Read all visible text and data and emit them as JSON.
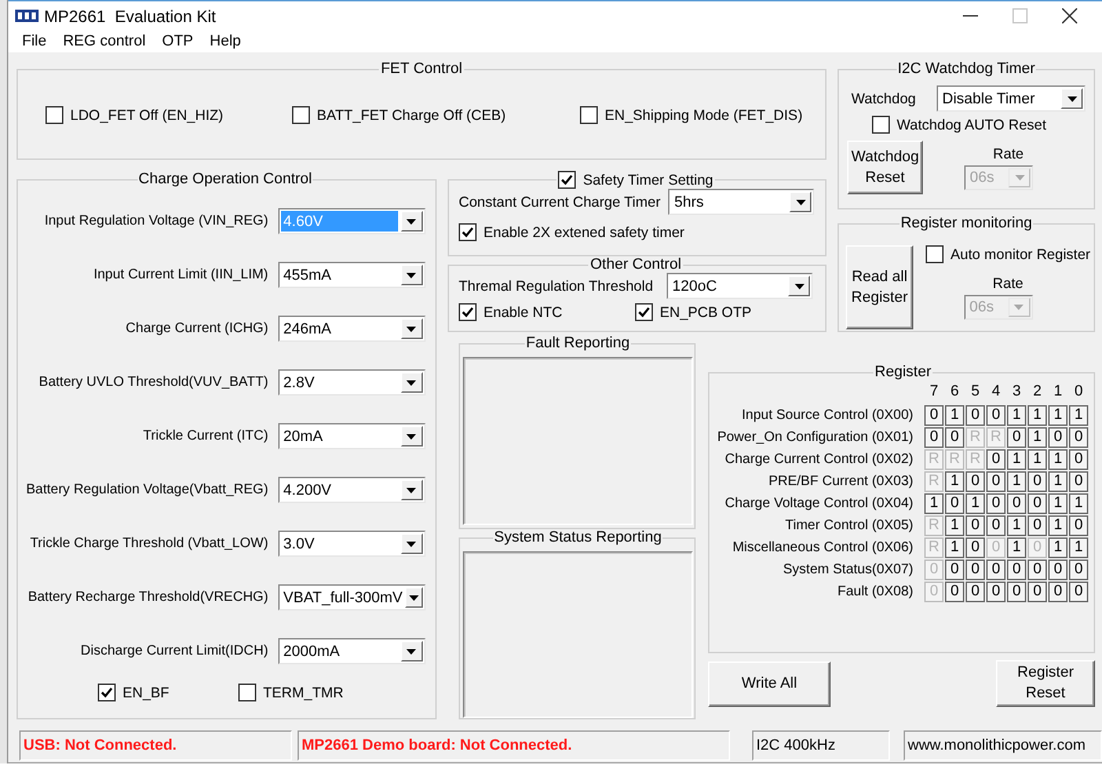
{
  "window": {
    "title": "MP2661  Evaluation Kit"
  },
  "menu": [
    "File",
    "REG control",
    "OTP",
    "Help"
  ],
  "fet_control": {
    "title": "FET Control",
    "options": [
      {
        "label": "LDO_FET Off (EN_HIZ)",
        "checked": false
      },
      {
        "label": "BATT_FET Charge Off (CEB)",
        "checked": false
      },
      {
        "label": "EN_Shipping Mode (FET_DIS)",
        "checked": false
      }
    ]
  },
  "charge_operation": {
    "title": "Charge Operation Control",
    "settings": [
      {
        "label": "Input Regulation Voltage (VIN_REG)",
        "value": "4.60V",
        "focused": true
      },
      {
        "label": "Input Current Limit (IIN_LIM)",
        "value": "455mA",
        "focused": false
      },
      {
        "label": "Charge Current (ICHG)",
        "value": "246mA",
        "focused": false
      },
      {
        "label": "Battery UVLO Threshold(VUV_BATT)",
        "value": "2.8V",
        "focused": false
      },
      {
        "label": "Trickle Current (ITC)",
        "value": "20mA",
        "focused": false
      },
      {
        "label": "Battery Regulation Voltage(Vbatt_REG)",
        "value": "4.200V",
        "focused": false
      },
      {
        "label": "Trickle Charge Threshold (Vbatt_LOW)",
        "value": "3.0V",
        "focused": false
      },
      {
        "label": "Battery Recharge Threshold(VRECHG)",
        "value": "VBAT_full-300mV",
        "focused": false
      },
      {
        "label": "Discharge Current Limit(IDCH)",
        "value": "2000mA",
        "focused": false
      }
    ],
    "options": [
      {
        "label": "EN_BF",
        "checked": true
      },
      {
        "label": "TERM_TMR",
        "checked": false
      }
    ]
  },
  "safety_timer": {
    "title": "Safety Timer Setting",
    "checked": true,
    "timer_label": "Constant Current Charge Timer",
    "timer_value": "5hrs",
    "options": [
      {
        "label": "Enable 2X extened safety timer",
        "checked": true
      }
    ]
  },
  "other_control": {
    "title": "Other Control",
    "threshold_label": "Thremal Regulation Threshold",
    "threshold_value": "120oC",
    "options": [
      {
        "label": "Enable NTC",
        "checked": true
      },
      {
        "label": "EN_PCB OTP",
        "checked": true
      }
    ]
  },
  "fault_reporting": {
    "title": "Fault Reporting"
  },
  "system_status_reporting": {
    "title": "System Status Reporting"
  },
  "watchdog": {
    "title": "I2C Watchdog Timer",
    "label": "Watchdog",
    "value": "Disable Timer",
    "auto_reset": {
      "label": "Watchdog AUTO Reset",
      "checked": false
    },
    "reset_button": "Watchdog Reset",
    "rate_label": "Rate",
    "rate": {
      "value": "06s",
      "disabled": true
    }
  },
  "register_monitoring": {
    "title": "Register monitoring",
    "read_button": "Read all Register",
    "auto_monitor": {
      "label": "Auto monitor Register",
      "checked": false
    },
    "rate_label": "Rate",
    "rate": {
      "value": "06s",
      "disabled": true
    }
  },
  "register": {
    "title": "Register",
    "bit_headers": [
      "7",
      "6",
      "5",
      "4",
      "3",
      "2",
      "1",
      "0"
    ],
    "rows": [
      {
        "label": "Input Source Control (0X00)",
        "bits": [
          {
            "text": "0",
            "disabled": false
          },
          {
            "text": "1",
            "disabled": false
          },
          {
            "text": "0",
            "disabled": false
          },
          {
            "text": "0",
            "disabled": false
          },
          {
            "text": "1",
            "disabled": false
          },
          {
            "text": "1",
            "disabled": false
          },
          {
            "text": "1",
            "disabled": false
          },
          {
            "text": "1",
            "disabled": false
          }
        ]
      },
      {
        "label": "Power_On Configuration (0X01)",
        "bits": [
          {
            "text": "0",
            "disabled": false
          },
          {
            "text": "0",
            "disabled": false
          },
          {
            "text": "R",
            "disabled": true
          },
          {
            "text": "R",
            "disabled": true
          },
          {
            "text": "0",
            "disabled": false
          },
          {
            "text": "1",
            "disabled": false
          },
          {
            "text": "0",
            "disabled": false
          },
          {
            "text": "0",
            "disabled": false
          }
        ]
      },
      {
        "label": "Charge Current Control (0X02)",
        "bits": [
          {
            "text": "R",
            "disabled": true
          },
          {
            "text": "R",
            "disabled": true
          },
          {
            "text": "R",
            "disabled": true
          },
          {
            "text": "0",
            "disabled": false
          },
          {
            "text": "1",
            "disabled": false
          },
          {
            "text": "1",
            "disabled": false
          },
          {
            "text": "1",
            "disabled": false
          },
          {
            "text": "0",
            "disabled": false
          }
        ]
      },
      {
        "label": "PRE/BF Current (0X03)",
        "bits": [
          {
            "text": "R",
            "disabled": true
          },
          {
            "text": "1",
            "disabled": false
          },
          {
            "text": "0",
            "disabled": false
          },
          {
            "text": "0",
            "disabled": false
          },
          {
            "text": "1",
            "disabled": false
          },
          {
            "text": "0",
            "disabled": false
          },
          {
            "text": "1",
            "disabled": false
          },
          {
            "text": "0",
            "disabled": false
          }
        ]
      },
      {
        "label": "Charge Voltage Control (0X04)",
        "bits": [
          {
            "text": "1",
            "disabled": false
          },
          {
            "text": "0",
            "disabled": false
          },
          {
            "text": "1",
            "disabled": false
          },
          {
            "text": "0",
            "disabled": false
          },
          {
            "text": "0",
            "disabled": false
          },
          {
            "text": "0",
            "disabled": false
          },
          {
            "text": "1",
            "disabled": false
          },
          {
            "text": "1",
            "disabled": false
          }
        ]
      },
      {
        "label": "Timer Control (0X05)",
        "bits": [
          {
            "text": "R",
            "disabled": true
          },
          {
            "text": "1",
            "disabled": false
          },
          {
            "text": "0",
            "disabled": false
          },
          {
            "text": "0",
            "disabled": false
          },
          {
            "text": "1",
            "disabled": false
          },
          {
            "text": "0",
            "disabled": false
          },
          {
            "text": "1",
            "disabled": false
          },
          {
            "text": "0",
            "disabled": false
          }
        ]
      },
      {
        "label": "Miscellaneous Control (0X06)",
        "bits": [
          {
            "text": "R",
            "disabled": true
          },
          {
            "text": "1",
            "disabled": false
          },
          {
            "text": "0",
            "disabled": false
          },
          {
            "text": "0",
            "disabled": true
          },
          {
            "text": "1",
            "disabled": false
          },
          {
            "text": "0",
            "disabled": true
          },
          {
            "text": "1",
            "disabled": false
          },
          {
            "text": "1",
            "disabled": false
          }
        ]
      },
      {
        "label": "System Status(0X07)",
        "bits": [
          {
            "text": "0",
            "disabled": true
          },
          {
            "text": "0",
            "disabled": false
          },
          {
            "text": "0",
            "disabled": false
          },
          {
            "text": "0",
            "disabled": false
          },
          {
            "text": "0",
            "disabled": false
          },
          {
            "text": "0",
            "disabled": false
          },
          {
            "text": "0",
            "disabled": false
          },
          {
            "text": "0",
            "disabled": false
          }
        ]
      },
      {
        "label": "Fault (0X08)",
        "bits": [
          {
            "text": "0",
            "disabled": true
          },
          {
            "text": "0",
            "disabled": false
          },
          {
            "text": "0",
            "disabled": false
          },
          {
            "text": "0",
            "disabled": false
          },
          {
            "text": "0",
            "disabled": false
          },
          {
            "text": "0",
            "disabled": false
          },
          {
            "text": "0",
            "disabled": false
          },
          {
            "text": "0",
            "disabled": false
          }
        ]
      }
    ]
  },
  "buttons": {
    "write_all": "Write All",
    "register_reset": "Register Reset"
  },
  "status_bar": [
    {
      "text": "USB: Not Connected.",
      "alert": true
    },
    {
      "text": "MP2661 Demo board: Not Connected.",
      "alert": true
    },
    {
      "text": "I2C 400kHz",
      "alert": false
    },
    {
      "text": "www.monolithicpower.com",
      "alert": false
    }
  ]
}
